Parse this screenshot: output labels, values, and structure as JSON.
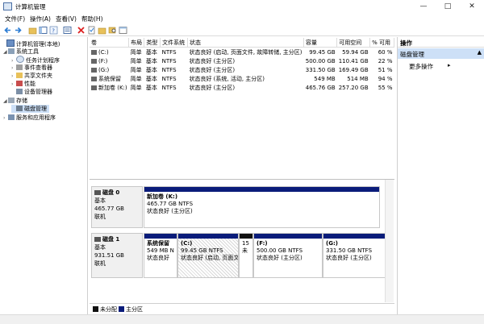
{
  "window": {
    "title": "计算机管理"
  },
  "menu": [
    "文件(F)",
    "操作(A)",
    "查看(V)",
    "帮助(H)"
  ],
  "tree": [
    {
      "label": "计算机管理(本地)",
      "icon": "computer-icon"
    },
    {
      "label": "系统工具",
      "icon": "tools-icon"
    },
    {
      "label": "任务计划程序",
      "icon": "clock-icon"
    },
    {
      "label": "事件查看器",
      "icon": "event-icon"
    },
    {
      "label": "共享文件夹",
      "icon": "folder-icon"
    },
    {
      "label": "性能",
      "icon": "performance-icon"
    },
    {
      "label": "设备管理器",
      "icon": "device-icon"
    },
    {
      "label": "存储",
      "icon": "storage-icon"
    },
    {
      "label": "磁盘管理",
      "icon": "disk-icon"
    },
    {
      "label": "服务和应用程序",
      "icon": "services-icon"
    }
  ],
  "volumes": {
    "columns": [
      "卷",
      "布局",
      "类型",
      "文件系统",
      "状态",
      "容量",
      "可用空间",
      "% 可用"
    ],
    "rows": [
      [
        "(C:)",
        "简单",
        "基本",
        "NTFS",
        "状态良好 (启动, 页面文件, 故障转储, 主分区)",
        "99.45 GB",
        "59.94 GB",
        "60 %"
      ],
      [
        "(F:)",
        "简单",
        "基本",
        "NTFS",
        "状态良好 (主分区)",
        "500.00 GB",
        "110.41 GB",
        "22 %"
      ],
      [
        "(G:)",
        "简单",
        "基本",
        "NTFS",
        "状态良好 (主分区)",
        "331.50 GB",
        "169.49 GB",
        "51 %"
      ],
      [
        "系统保留",
        "简单",
        "基本",
        "NTFS",
        "状态良好 (系统, 活动, 主分区)",
        "549 MB",
        "514 MB",
        "94 %"
      ],
      [
        "新加卷 (K:)",
        "简单",
        "基本",
        "NTFS",
        "状态良好 (主分区)",
        "465.76 GB",
        "257.20 GB",
        "55 %"
      ]
    ]
  },
  "actions": {
    "header": "操作",
    "selected": "磁盘管理",
    "more": "更多操作"
  },
  "disk0": {
    "name": "磁盘 0",
    "type": "基本",
    "size": "465.77 GB",
    "status": "联机",
    "part": {
      "name": "新加卷 (K:)",
      "size": "465.77 GB NTFS",
      "status": "状态良好 (主分区)"
    }
  },
  "disk1": {
    "name": "磁盘 1",
    "type": "基本",
    "size": "931.51 GB",
    "status": "联机",
    "parts": [
      {
        "name": "系统保留",
        "size": "549 MB N",
        "status": "状态良好"
      },
      {
        "name": "(C:)",
        "size": "99.45 GB NTFS",
        "status": "状态良好 (启动, 页面文"
      },
      {
        "name": "",
        "size": "15",
        "status": "未"
      },
      {
        "name": "(F:)",
        "size": "500.00 GB NTFS",
        "status": "状态良好 (主分区)"
      },
      {
        "name": "(G:)",
        "size": "331.50 GB NTFS",
        "status": "状态良好 (主分区)"
      }
    ]
  },
  "legend": {
    "unallocated": "未分配",
    "primary": "主分区"
  },
  "colors": {
    "primary": "#0a1c7a",
    "unallocated": "#111111",
    "selection": "#cde0f7"
  }
}
